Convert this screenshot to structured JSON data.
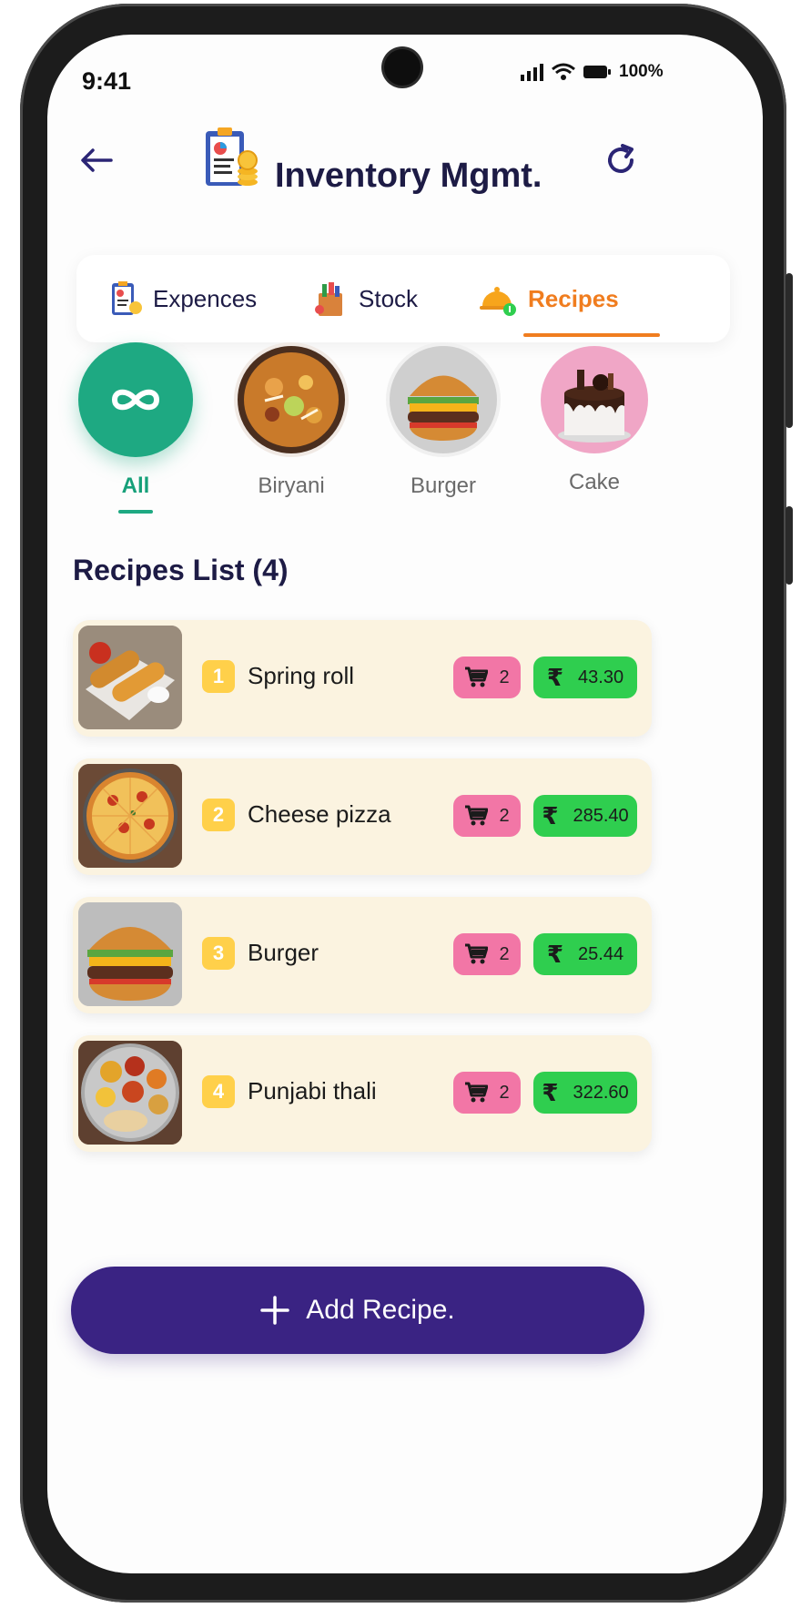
{
  "status_bar": {
    "time": "9:41",
    "battery": "100%"
  },
  "header": {
    "title": "Inventory Mgmt."
  },
  "tabs": [
    {
      "label": "Expences",
      "icon": "clipboard-icon"
    },
    {
      "label": "Stock",
      "icon": "grocery-bag-icon"
    },
    {
      "label": "Recipes",
      "icon": "cloche-icon",
      "active": true
    }
  ],
  "categories": [
    {
      "label": "All",
      "icon": "infinity-icon",
      "active": true
    },
    {
      "label": "Biryani",
      "icon": "biryani-photo"
    },
    {
      "label": "Burger",
      "icon": "burger-photo"
    },
    {
      "label": "Cake",
      "icon": "cake-photo"
    }
  ],
  "list": {
    "title": "Recipes List (4)",
    "items": [
      {
        "index": "1",
        "name": "Spring roll",
        "cart_count": "2",
        "price": "43.30"
      },
      {
        "index": "2",
        "name": "Cheese pizza",
        "cart_count": "2",
        "price": "285.40"
      },
      {
        "index": "3",
        "name": "Burger",
        "cart_count": "2",
        "price": "25.44"
      },
      {
        "index": "4",
        "name": "Punjabi thali",
        "cart_count": "2",
        "price": "322.60"
      }
    ]
  },
  "footer": {
    "add_label": "Add Recipe."
  },
  "colors": {
    "accent_orange": "#f07d1f",
    "primary_purple": "#3a2383",
    "all_green": "#1ea982",
    "price_green": "#2fce4f",
    "cart_pink": "#f276a6"
  }
}
